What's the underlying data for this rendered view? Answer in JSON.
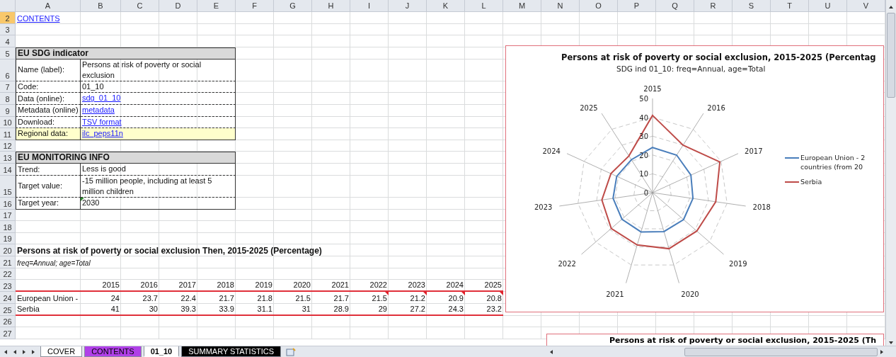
{
  "columns": [
    "A",
    "B",
    "C",
    "D",
    "E",
    "F",
    "G",
    "H",
    "I",
    "J",
    "K",
    "L",
    "M",
    "N",
    "O",
    "P",
    "Q",
    "R",
    "S",
    "T",
    "U",
    "V"
  ],
  "rows": [
    {
      "label": "2",
      "selected": true
    },
    {
      "label": "3",
      "selected": false
    },
    {
      "label": "4",
      "selected": false
    },
    {
      "label": "5",
      "selected": false
    },
    {
      "label": "6",
      "selected": false
    },
    {
      "label": "7",
      "selected": false
    },
    {
      "label": "8",
      "selected": false
    },
    {
      "label": "9",
      "selected": false
    },
    {
      "label": "10",
      "selected": false
    },
    {
      "label": "11",
      "selected": false
    },
    {
      "label": "12",
      "selected": false
    },
    {
      "label": "13",
      "selected": false
    },
    {
      "label": "14",
      "selected": false
    },
    {
      "label": "15",
      "selected": false
    },
    {
      "label": "16",
      "selected": false
    },
    {
      "label": "17",
      "selected": false
    },
    {
      "label": "18",
      "selected": false
    },
    {
      "label": "19",
      "selected": false
    },
    {
      "label": "20",
      "selected": false
    },
    {
      "label": "21",
      "selected": false
    },
    {
      "label": "22",
      "selected": false
    },
    {
      "label": "23",
      "selected": false
    },
    {
      "label": "24",
      "selected": false
    },
    {
      "label": "25",
      "selected": false
    },
    {
      "label": "26",
      "selected": false
    },
    {
      "label": "27",
      "selected": false
    }
  ],
  "contents_link": "CONTENTS",
  "indicator": {
    "title": "EU SDG indicator",
    "fields": [
      {
        "label": "Name (label):",
        "value": "Persons at risk of poverty or social exclusion",
        "kind": "text",
        "highlighted": false
      },
      {
        "label": "Code:",
        "value": "01_10",
        "kind": "text",
        "highlighted": false
      },
      {
        "label": "Data (online):",
        "value": "sdg_01_10",
        "kind": "link",
        "highlighted": false
      },
      {
        "label": "Metadata (online)",
        "value": "metadata",
        "kind": "link",
        "highlighted": false
      },
      {
        "label": "Download:",
        "value": "TSV format",
        "kind": "link",
        "highlighted": false
      },
      {
        "label": "Regional data:",
        "value": "ilc_peps11n",
        "kind": "link",
        "highlighted": true
      }
    ]
  },
  "monitoring": {
    "title": "EU MONITORING INFO",
    "fields": [
      {
        "label": "Trend:",
        "value": "Less is good",
        "kind": "text",
        "warning": false
      },
      {
        "label": "Target value:",
        "value": "-15 million people, including at least 5 million children",
        "kind": "text",
        "warning": false
      },
      {
        "label": "Target year:",
        "value": "2030",
        "kind": "text",
        "warning": true
      }
    ]
  },
  "table": {
    "title": "Persons at risk of poverty or social exclusion Then, 2015-2025 (Percentage)",
    "subtitle": "freq=Annual; age=Total",
    "years": [
      "2015",
      "2016",
      "2017",
      "2018",
      "2019",
      "2020",
      "2021",
      "2022",
      "2023",
      "2024",
      "2025"
    ],
    "rows": [
      {
        "name": "European Union -",
        "cells": [
          {
            "value": "24",
            "flagged": false
          },
          {
            "value": "23.7",
            "flagged": false
          },
          {
            "value": "22.4",
            "flagged": false
          },
          {
            "value": "21.7",
            "flagged": false
          },
          {
            "value": "21.8",
            "flagged": false
          },
          {
            "value": "21.5",
            "flagged": false
          },
          {
            "value": "21.7",
            "flagged": false
          },
          {
            "value": "21.5",
            "flagged": true
          },
          {
            "value": "21.2",
            "flagged": true
          },
          {
            "value": "20.9",
            "flagged": true
          },
          {
            "value": "20.8",
            "flagged": true
          }
        ]
      },
      {
        "name": "Serbia",
        "cells": [
          {
            "value": "41",
            "flagged": false
          },
          {
            "value": "30",
            "flagged": false
          },
          {
            "value": "39.3",
            "flagged": false
          },
          {
            "value": "33.9",
            "flagged": false
          },
          {
            "value": "31.1",
            "flagged": false
          },
          {
            "value": "31",
            "flagged": false
          },
          {
            "value": "28.9",
            "flagged": false
          },
          {
            "value": "29",
            "flagged": false
          },
          {
            "value": "27.2",
            "flagged": false
          },
          {
            "value": "24.3",
            "flagged": false
          },
          {
            "value": "23.2",
            "flagged": false
          }
        ]
      }
    ]
  },
  "chart": {
    "title": "Persons at risk of poverty or social exclusion, 2015-2025 (Percentag",
    "subtitle": "SDG ind 01_10: freq=Annual,  age=Total",
    "axis_labels": [
      "2015",
      "2016",
      "2017",
      "2018",
      "2019",
      "2020",
      "2021",
      "2022",
      "2023",
      "2024",
      "2025"
    ],
    "tick_labels": [
      "50",
      "40",
      "30",
      "20",
      "10",
      "0"
    ],
    "legend": [
      {
        "name": "European Union - 2 countries (from 20",
        "color": "#4a7ebb"
      },
      {
        "name": "Serbia",
        "color": "#be4b48"
      }
    ]
  },
  "chart2": {
    "title": "Persons at risk of poverty or social exclusion, 2015-2025 (Th"
  },
  "sheet_tabs": [
    {
      "label": "COVER",
      "selected": false,
      "color": "#ffffff"
    },
    {
      "label": "CONTENTS",
      "selected": false,
      "color": "#b040e8"
    },
    {
      "label": "01_10",
      "selected": true,
      "color": "#ffffff"
    },
    {
      "label": "SUMMARY STATISTICS",
      "selected": false,
      "color": "#000000"
    }
  ]
}
